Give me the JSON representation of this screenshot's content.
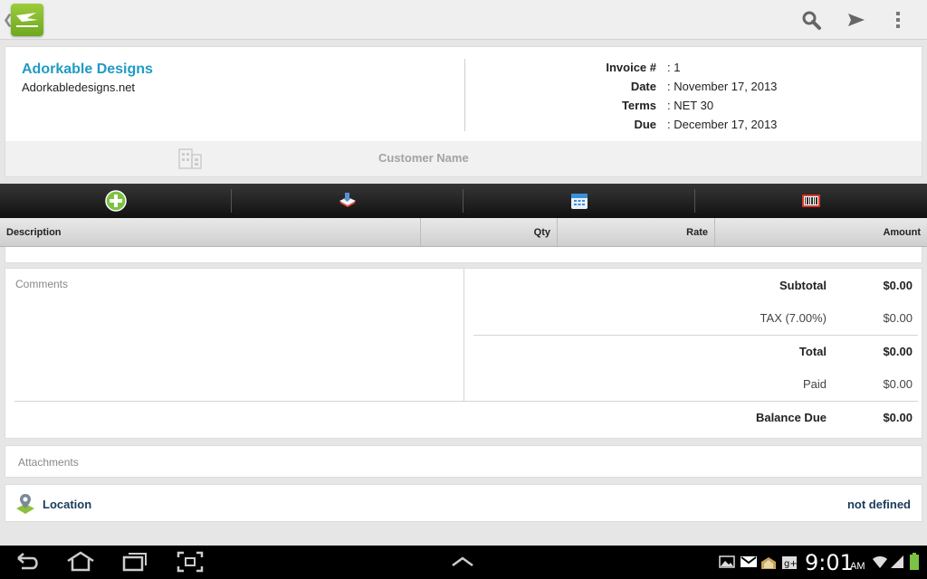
{
  "company": {
    "name": "Adorkable Designs",
    "website": "Adorkabledesigns.net"
  },
  "invoice_meta": [
    {
      "label": "Invoice #",
      "value": ": 1"
    },
    {
      "label": "Date",
      "value": ": November 17, 2013"
    },
    {
      "label": "Terms",
      "value": ": NET 30"
    },
    {
      "label": "Due",
      "value": ": December 17, 2013"
    }
  ],
  "customer": {
    "placeholder": "Customer Name"
  },
  "toolbar": {
    "icons": [
      "add-item-icon",
      "product-catalog-icon",
      "time-entry-icon",
      "barcode-scan-icon"
    ]
  },
  "items": {
    "columns": [
      "Description",
      "Qty",
      "Rate",
      "Amount"
    ]
  },
  "comments": {
    "label": "Comments"
  },
  "totals": [
    {
      "label": "Subtotal",
      "value": "$0.00",
      "bold": true
    },
    {
      "label": "TAX (7.00%)",
      "value": "$0.00",
      "bold": false
    },
    {
      "label": "Total",
      "value": "$0.00",
      "bold": true
    },
    {
      "label": "Paid",
      "value": "$0.00",
      "bold": false
    },
    {
      "label": "Balance Due",
      "value": "$0.00",
      "bold": true
    }
  ],
  "attachments": {
    "label": "Attachments"
  },
  "location": {
    "label": "Location",
    "value": "not defined"
  },
  "status_bar": {
    "time": "9:01",
    "ampm": "AM"
  },
  "colors": {
    "accent": "#1f9bc4",
    "location_text": "#1b3a5c",
    "toolbar_bg": "#1a1a1a",
    "app_logo": "#7ab82a"
  }
}
